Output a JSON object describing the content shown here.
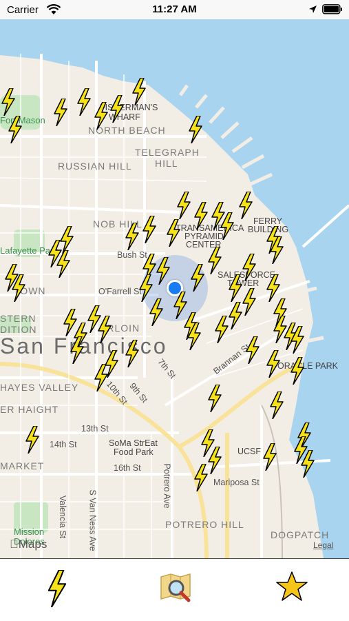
{
  "status_bar": {
    "carrier": "Carrier",
    "time": "11:27 AM"
  },
  "map": {
    "neighborhoods": [
      "NORTH BEACH",
      "TELEGRAPH",
      "HILL",
      "RUSSIAN HILL",
      "NOB HILL",
      "San Francisco",
      "HAYES VALLEY",
      "ER HAIGHT",
      "MARKET",
      "POTRERO HILL",
      "DOGPATCH",
      "TOWN",
      "STERN",
      "DITION",
      "ERLOIN"
    ],
    "landmarks": [
      "FISHERMAN'S",
      "WHARF",
      "FERRY",
      "BUILDING",
      "TRANSAMERICA",
      "PYRAMID",
      "CENTER",
      "SALESFORCE",
      "TOWER",
      "ORACLE PARK",
      "UCSF",
      "SoMa StrEat",
      "Food Park"
    ],
    "parks": [
      "Fort Mason",
      "Lafayette Park",
      "Mission",
      "Dolores"
    ],
    "streets": [
      "Bush St",
      "O'Farrell St",
      "7th St",
      "10th St",
      "9th St",
      "13th St",
      "14th St",
      "16th St",
      "Brannan St",
      "Mariposa St",
      "Potrero Ave",
      "S Van Ness Ave",
      "Valencia St"
    ],
    "maps_logo": "Maps",
    "legal": "Legal"
  },
  "tab_bar": {
    "items": [
      {
        "name": "charging-stations-tab",
        "icon": "lightning-bolt-icon"
      },
      {
        "name": "search-map-tab",
        "icon": "map-search-icon"
      },
      {
        "name": "favorites-tab",
        "icon": "star-icon"
      }
    ]
  },
  "colors": {
    "water": "#a8d4f0",
    "land": "#f3eee5",
    "park": "#c8e6c1",
    "bolt_fill": "#f5e21a",
    "user_location": "#1a7cf2",
    "star": "#f5c518"
  }
}
